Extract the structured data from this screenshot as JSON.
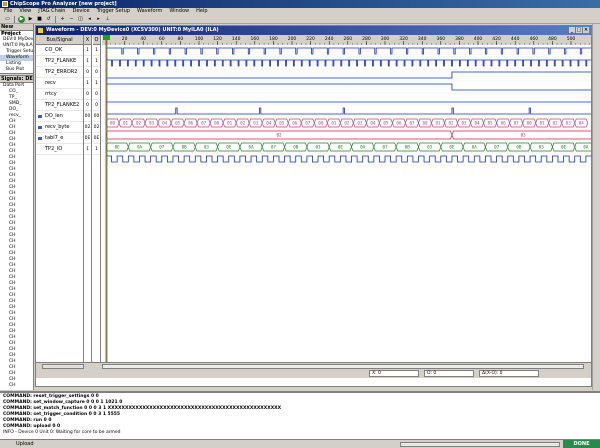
{
  "app": {
    "title": "ChipScope Pro Analyzer [new project]"
  },
  "menu": [
    "File",
    "View",
    "JTAG Chain",
    "Device",
    "Trigger Setup",
    "Waveform",
    "Window",
    "Help"
  ],
  "left_panel": {
    "project_head": "New Project",
    "project_items": [
      "new",
      "DEV:0 MyDevice0",
      "UNIT:0 MyILA0",
      "Trigger Setup",
      "Waveform",
      "Listing",
      "Bus Plot"
    ],
    "signals_head": "Signals: DE",
    "signal_items": [
      "Data Port",
      "CO_",
      "TP_",
      "SMD_",
      "DO_",
      "recv_",
      "CH",
      "CH",
      "CH",
      "CH",
      "CH",
      "CH",
      "CH",
      "CH",
      "CH",
      "CH",
      "CH",
      "CH",
      "CH",
      "CH",
      "CH",
      "CH",
      "CH",
      "CH",
      "CH",
      "CH",
      "CH",
      "CH",
      "CH",
      "CH",
      "CH",
      "CH",
      "CH",
      "CH",
      "CH",
      "CH",
      "CH",
      "CH",
      "CH",
      "CH",
      "CH",
      "CH",
      "CH",
      "CH",
      "CH",
      "CH",
      "CH",
      "CH",
      "CH",
      "CH",
      "CH"
    ]
  },
  "waveform": {
    "title": "Waveform - DEV:0 MyDevice0 (XC5V300) UNIT:0 MyILA0 (ILA)",
    "col_bus": "Bus/Signal",
    "col_x": "X",
    "col_o": "O",
    "ruler": [
      "0",
      "20",
      "40",
      "60",
      "80",
      "100",
      "120",
      "140",
      "160",
      "180",
      "200",
      "220",
      "240",
      "260",
      "280",
      "300",
      "320",
      "340",
      "360",
      "380",
      "400",
      "420",
      "440",
      "460",
      "480",
      "500"
    ],
    "signals": [
      {
        "name": "CO_OK",
        "x": "1",
        "o": "1",
        "bus": false
      },
      {
        "name": "TP2_FLANKE",
        "x": "1",
        "o": "1",
        "bus": false
      },
      {
        "name": "TP2_ERROR2",
        "x": "0",
        "o": "0",
        "bus": false
      },
      {
        "name": "recv",
        "x": "1",
        "o": "1",
        "bus": false
      },
      {
        "name": "rrtcy",
        "x": "0",
        "o": "0",
        "bus": false
      },
      {
        "name": "TP2_FLANKE2",
        "x": "0",
        "o": "0",
        "bus": false
      },
      {
        "name": "DO_len",
        "x": "00",
        "o": "00",
        "bus": true
      },
      {
        "name": "recv_byte",
        "x": "02",
        "o": "02",
        "bus": true
      },
      {
        "name": "tabl7_e",
        "x": "0E",
        "o": "0E",
        "bus": true
      },
      {
        "name": "TP2_IO",
        "x": "1",
        "o": "1",
        "bus": false
      }
    ],
    "bus_values": {
      "do_len": [
        "00",
        "01",
        "02",
        "03",
        "04",
        "05",
        "06",
        "07",
        "00",
        "01",
        "02",
        "03",
        "04",
        "05",
        "06",
        "07",
        "00",
        "01",
        "02",
        "03",
        "04",
        "05",
        "06",
        "07",
        "00",
        "01",
        "02",
        "03",
        "04",
        "05",
        "06",
        "07",
        "00",
        "01",
        "02",
        "03",
        "04"
      ],
      "recv_byte": [
        "02",
        "03"
      ],
      "tabl7": [
        "0E",
        "0A",
        "07",
        "0B",
        "03",
        "0E",
        "0A",
        "07",
        "0B",
        "03",
        "0E",
        "0A",
        "07",
        "0B",
        "03",
        "0E",
        "0A",
        "07",
        "0B",
        "03",
        "0E",
        "0A"
      ]
    },
    "cursor_x": "X: 0",
    "cursor_o": "O: 0",
    "cursor_delta": "Δ(X-O): 0"
  },
  "console": [
    "COMMAND: reset_trigger_settings 0 0",
    "COMMAND: set_window_capture 0 0 0 1 1021 0",
    "COMMAND: set_match_function 0 0 0 3 1 XXXXXXXXXXXXXXXXXXXXXXXXXXXXXXXXXXXXXXXXXXXXXXXXXX",
    "COMMAND: set_trigger_condition 0 0 3 1 5555",
    "COMMAND: run 0 0",
    "COMMAND: upload 0 0",
    "INFO - Device 0 Unit 0:  Waiting for core to be armed"
  ],
  "status": {
    "upload": "Upload",
    "done": "DONE"
  },
  "colors": {
    "wave_blue": "#1030c0",
    "bus_green": "#208020",
    "bus_red": "#d02040",
    "bus_pink": "#c04080"
  }
}
